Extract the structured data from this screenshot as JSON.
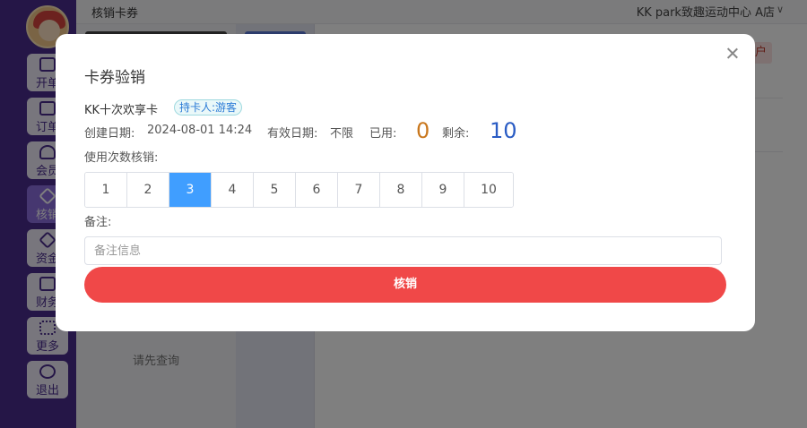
{
  "app": {
    "header_title": "核销卡券",
    "store_name": "KK park致趣运动中心 A店",
    "nav_items": [
      {
        "label": "开单",
        "icon": "cart-shop-icon"
      },
      {
        "label": "订单",
        "icon": "cart-icon"
      },
      {
        "label": "会员",
        "icon": "user-icon"
      },
      {
        "label": "核销",
        "icon": "diamond-icon",
        "active": true
      },
      {
        "label": "资金",
        "icon": "money-icon"
      },
      {
        "label": "财务",
        "icon": "finance-icon"
      },
      {
        "label": "更多",
        "icon": "grid-icon"
      },
      {
        "label": "退出",
        "icon": "logout-icon"
      }
    ],
    "empty_query_text": "请先查询",
    "colors": {
      "sidebar": "#4a2d8f",
      "accent": "#409eff",
      "danger": "#f04848"
    }
  },
  "modal": {
    "title": "卡券验销",
    "card_name": "KK十次欢享卡",
    "holder_tag": "持卡人:游客",
    "created_label": "创建日期:",
    "created_value": "2024-08-01 14:24",
    "valid_label": "有效日期:",
    "valid_value": "不限",
    "used_label": "已用:",
    "used_value": "0",
    "remaining_label": "剩余:",
    "remaining_value": "10",
    "use_count_label": "使用次数核销:",
    "counts": [
      "1",
      "2",
      "3",
      "4",
      "5",
      "6",
      "7",
      "8",
      "9",
      "10"
    ],
    "selected_count": "3",
    "remark_label": "备注:",
    "remark_placeholder": "备注信息",
    "remark_value": "",
    "submit_label": "核销"
  }
}
